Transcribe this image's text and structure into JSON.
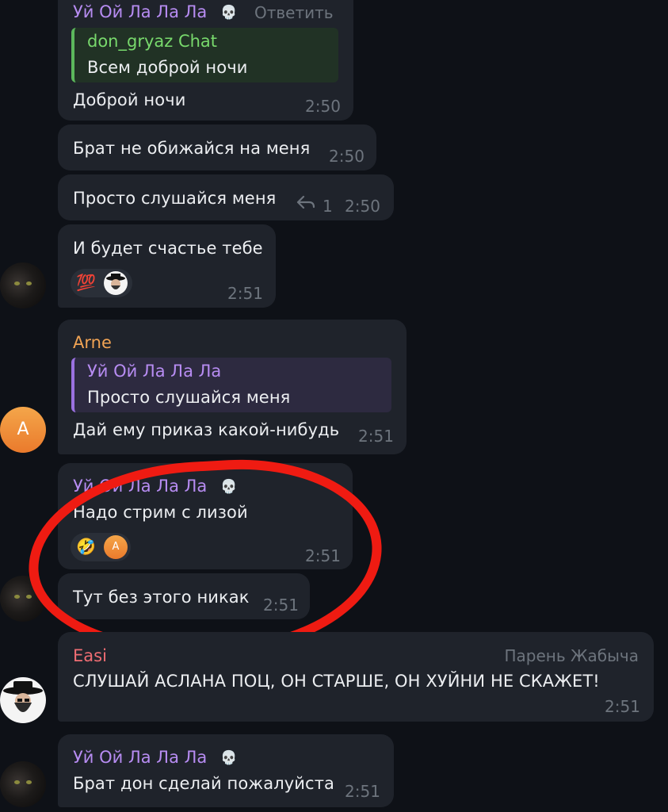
{
  "messages": [
    {
      "id": "m1",
      "sender": "Уй Ой Ла Ла Ла",
      "reply_action": "Ответить",
      "quote_author": "don_gryaz Chat",
      "quote_text": "Всем доброй ночи",
      "text": "Доброй ночи",
      "time": "2:50"
    },
    {
      "id": "m2",
      "text": "Брат не обижайся на меня",
      "time": "2:50"
    },
    {
      "id": "m3",
      "text": "Просто слушайся меня",
      "reply_count": "1",
      "time": "2:50"
    },
    {
      "id": "m4",
      "text": "И будет счастье тебе",
      "reaction_emoji": "💯",
      "time": "2:51"
    },
    {
      "id": "m5",
      "sender": "Arne",
      "quote_author": "Уй Ой Ла Ла Ла",
      "quote_text": "Просто слушайся меня",
      "text": "Дай ему приказ какой-нибудь",
      "time": "2:51",
      "avatar_letter": "A"
    },
    {
      "id": "m6",
      "sender": "Уй Ой Ла Ла Ла",
      "text": "Надо стрим с лизой",
      "reaction_emoji": "🤣",
      "reaction_avatar_letter": "A",
      "time": "2:51"
    },
    {
      "id": "m7",
      "text": "Тут без этого никак",
      "time": "2:51"
    },
    {
      "id": "m8",
      "sender": "Easi",
      "sender_title": "Парень Жабыча",
      "text": "СЛУШАЙ АСЛАНА ПОЦ, ОН СТАРШЕ, ОН ХУЙНИ НЕ СКАЖЕТ!",
      "time": "2:51"
    },
    {
      "id": "m9",
      "sender": "Уй Ой Ла Ла Ла",
      "text": "Брат дон сделай пожалуйста",
      "time": "2:51"
    }
  ],
  "colors": {
    "annotation_circle": "#ef1b12",
    "sender_purple": "#b78cf2",
    "sender_orange": "#f0a354",
    "sender_red": "#ef6d73"
  }
}
